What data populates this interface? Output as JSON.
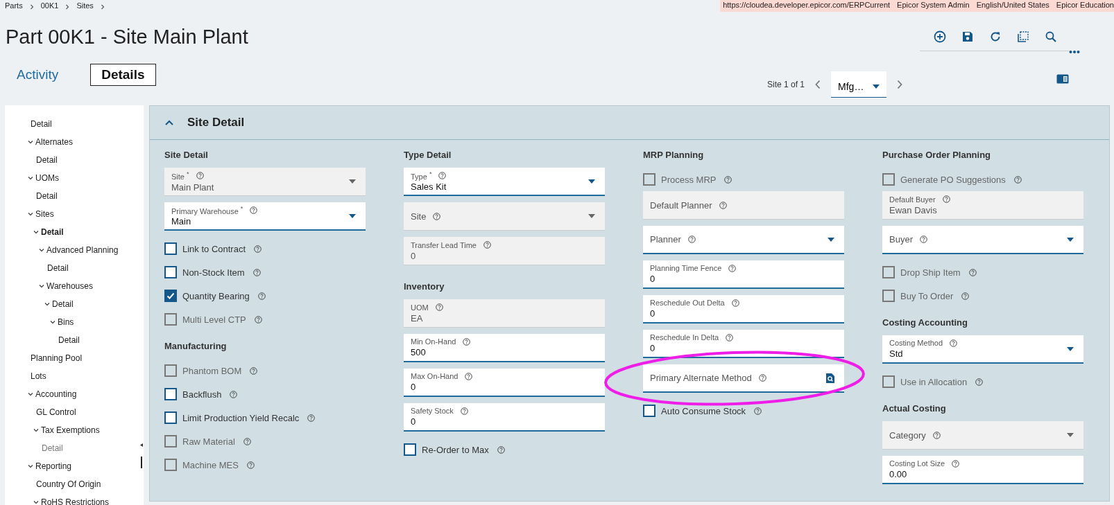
{
  "breadcrumb": [
    "Parts",
    "00K1",
    "Sites"
  ],
  "session_bar": [
    "https://cloudea.developer.epicor.com/ERPCurrent",
    "Epicor System Admin",
    "English/United States",
    "Epicor Education"
  ],
  "title": "Part 00K1 - Site Main Plant",
  "tabs": [
    {
      "label": "Activity",
      "selected": false
    },
    {
      "label": "Details",
      "selected": true
    }
  ],
  "record_nav": {
    "position": "Site 1 of 1",
    "selector": "Mfg…"
  },
  "tree": [
    {
      "label": "Detail",
      "selected": false,
      "disabled": false
    },
    {
      "label": "Alternates",
      "selected": false,
      "disabled": false,
      "expanded": true,
      "children": [
        {
          "label": "Detail",
          "selected": false,
          "disabled": false
        }
      ]
    },
    {
      "label": "UOMs",
      "selected": false,
      "disabled": false,
      "expanded": true,
      "children": [
        {
          "label": "Detail",
          "selected": false,
          "disabled": false
        }
      ]
    },
    {
      "label": "Sites",
      "selected": false,
      "disabled": false,
      "expanded": true,
      "children": [
        {
          "label": "Detail",
          "selected": true,
          "disabled": false,
          "expanded": true,
          "children": [
            {
              "label": "Advanced Planning",
              "selected": false,
              "disabled": false,
              "expanded": true,
              "children": [
                {
                  "label": "Detail",
                  "selected": false,
                  "disabled": false
                }
              ]
            },
            {
              "label": "Warehouses",
              "selected": false,
              "disabled": false,
              "expanded": true,
              "children": [
                {
                  "label": "Detail",
                  "selected": false,
                  "disabled": false,
                  "expanded": true,
                  "children": [
                    {
                      "label": "Bins",
                      "selected": false,
                      "disabled": false,
                      "expanded": true,
                      "children": [
                        {
                          "label": "Detail",
                          "selected": false,
                          "disabled": false
                        }
                      ]
                    }
                  ]
                }
              ]
            }
          ]
        }
      ]
    },
    {
      "label": "Planning Pool",
      "selected": false,
      "disabled": false
    },
    {
      "label": "Lots",
      "selected": false,
      "disabled": false
    },
    {
      "label": "Accounting",
      "selected": false,
      "disabled": false,
      "expanded": true,
      "children": [
        {
          "label": "GL Control",
          "selected": false,
          "disabled": false
        },
        {
          "label": "Tax Exemptions",
          "selected": false,
          "disabled": false,
          "expanded": true,
          "children": [
            {
              "label": "Detail",
              "selected": false,
              "disabled": true
            }
          ]
        }
      ]
    },
    {
      "label": "Reporting",
      "selected": false,
      "disabled": false,
      "expanded": true,
      "children": [
        {
          "label": "Country Of Origin",
          "selected": false,
          "disabled": false
        },
        {
          "label": "RoHS Restrictions",
          "selected": false,
          "disabled": false,
          "expanded": true
        }
      ]
    }
  ],
  "panel": {
    "title": "Site Detail",
    "expanded": true,
    "columns": [
      {
        "items": [
          {
            "kind": "heading",
            "label": "Site Detail"
          },
          {
            "kind": "dropdown",
            "label": "Site $^{*}$",
            "value": "Main Plant",
            "editable": false,
            "highlighted": false
          },
          {
            "kind": "dropdown",
            "label": "Primary Warehouse $^{*}$",
            "value": "Main",
            "editable": true,
            "highlighted": false
          },
          {
            "kind": "checkbox",
            "label": "Link to Contract",
            "checked": false,
            "disabled": false
          },
          {
            "kind": "checkbox",
            "label": "Non-Stock Item",
            "checked": false,
            "disabled": false
          },
          {
            "kind": "checkbox",
            "label": "Quantity Bearing",
            "checked": true,
            "disabled": false
          },
          {
            "kind": "checkbox",
            "label": "Multi Level CTP",
            "checked": false,
            "disabled": true
          },
          {
            "kind": "heading",
            "label": "Manufacturing"
          },
          {
            "kind": "checkbox",
            "label": "Phantom BOM",
            "checked": false,
            "disabled": true
          },
          {
            "kind": "checkbox",
            "label": "Backflush",
            "checked": false,
            "disabled": false
          },
          {
            "kind": "checkbox",
            "label": "Limit Production Yield Recalc",
            "checked": false,
            "disabled": false
          },
          {
            "kind": "checkbox",
            "label": "Raw Material",
            "checked": false,
            "disabled": true
          },
          {
            "kind": "checkbox",
            "label": "Machine MES",
            "checked": false,
            "disabled": true
          }
        ]
      },
      {
        "items": [
          {
            "kind": "heading",
            "label": "Type Detail"
          },
          {
            "kind": "dropdown",
            "label": "Type $^{*}$",
            "value": "Sales Kit",
            "editable": true,
            "highlighted": false
          },
          {
            "kind": "dropdown",
            "label": "Site",
            "editable": false,
            "highlighted": false
          },
          {
            "kind": "textfield",
            "label": "Transfer Lead Time",
            "value": "0",
            "editable": false,
            "highlighted": false
          },
          {
            "kind": "heading",
            "label": "Inventory"
          },
          {
            "kind": "textfield",
            "label": "UOM",
            "value": "EA",
            "editable": false,
            "highlighted": false
          },
          {
            "kind": "textfield",
            "label": "Min On-Hand",
            "value": "500",
            "editable": true,
            "highlighted": false
          },
          {
            "kind": "textfield",
            "label": "Max On-Hand",
            "value": "0",
            "editable": true,
            "highlighted": false
          },
          {
            "kind": "textfield",
            "label": "Safety Stock",
            "value": "0",
            "editable": true,
            "highlighted": false
          },
          {
            "kind": "checkbox",
            "label": "Re-Order to Max",
            "checked": false,
            "disabled": false
          }
        ]
      },
      {
        "items": [
          {
            "kind": "heading",
            "label": "MRP Planning"
          },
          {
            "kind": "checkbox",
            "label": "Process MRP",
            "checked": false,
            "disabled": true
          },
          {
            "kind": "textfield",
            "label": "Default Planner",
            "editable": false,
            "highlighted": false
          },
          {
            "kind": "dropdown",
            "label": "Planner",
            "editable": true,
            "highlighted": false
          },
          {
            "kind": "textfield",
            "label": "Planning Time Fence",
            "value": "0",
            "editable": true,
            "highlighted": false
          },
          {
            "kind": "textfield",
            "label": "Reschedule Out Delta",
            "value": "0",
            "editable": true,
            "highlighted": false
          },
          {
            "kind": "textfield",
            "label": "Reschedule In Delta",
            "value": "0",
            "editable": true,
            "highlighted": false
          },
          {
            "kind": "lookup",
            "label": "Primary Alternate Method",
            "editable": true,
            "highlighted": true
          },
          {
            "kind": "checkbox",
            "label": "Auto Consume Stock",
            "checked": false,
            "disabled": false
          }
        ]
      },
      {
        "items": [
          {
            "kind": "heading",
            "label": "Purchase Order Planning"
          },
          {
            "kind": "checkbox",
            "label": "Generate PO Suggestions",
            "checked": false,
            "disabled": true
          },
          {
            "kind": "textfield",
            "label": "Default Buyer",
            "value": "Ewan Davis",
            "editable": false,
            "highlighted": false
          },
          {
            "kind": "dropdown",
            "label": "Buyer",
            "editable": true,
            "highlighted": false
          },
          {
            "kind": "checkbox",
            "label": "Drop Ship Item",
            "checked": false,
            "disabled": true
          },
          {
            "kind": "checkbox",
            "label": "Buy To Order",
            "checked": false,
            "disabled": true
          },
          {
            "kind": "heading",
            "label": "Costing Accounting"
          },
          {
            "kind": "dropdown",
            "label": "Costing Method",
            "value": "Std",
            "editable": true,
            "highlighted": false
          },
          {
            "kind": "checkbox",
            "label": "Use in Allocation",
            "checked": false,
            "disabled": true
          },
          {
            "kind": "heading",
            "label": "Actual Costing"
          },
          {
            "kind": "dropdown",
            "label": "Category",
            "editable": false,
            "highlighted": false
          },
          {
            "kind": "textfield",
            "label": "Costing Lot Size",
            "value": "0.00",
            "editable": true,
            "highlighted": false
          }
        ]
      }
    ]
  }
}
